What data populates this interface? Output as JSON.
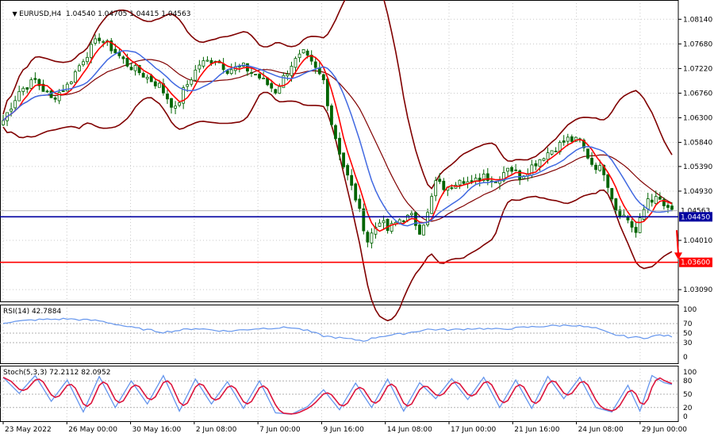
{
  "header": {
    "symbol": "EURUSD,H4",
    "ohlc": "1.04540 1.04705 1.04415 1.04563"
  },
  "rsi": {
    "label": "RSI(14) 42.7884",
    "axis_labels": [
      "100",
      "70",
      "50",
      "30",
      "0"
    ]
  },
  "stoch": {
    "label": "Stoch(5,3,3) 72.2112 82.0952",
    "axis_labels": [
      "100",
      "80",
      "50",
      "20",
      "0"
    ]
  },
  "colors": {
    "candle": "#006400",
    "bollinger": "#800000",
    "fast_ma": "#ff0000",
    "slow_ma": "#4169e1",
    "support_line": "#0000a0",
    "target_line": "#ff0000",
    "arrow": "#ff0000",
    "rsi": "#6495ed",
    "stoch_main": "#6495ed",
    "stoch_signal": "#dc143c"
  },
  "chart_data": {
    "type": "candlestick",
    "symbol": "EURUSD",
    "timeframe": "H4",
    "price_axis": {
      "labels": [
        "1.08140",
        "1.07680",
        "1.07220",
        "1.06760",
        "1.06300",
        "1.05840",
        "1.05390",
        "1.04930",
        "1.04010",
        "1.03090"
      ],
      "ylim": [
        1.0287,
        1.085
      ]
    },
    "time_axis": {
      "labels": [
        "23 May 2022",
        "26 May 00:00",
        "30 May 16:00",
        "2 Jun 08:00",
        "7 Jun 00:00",
        "9 Jun 16:00",
        "14 Jun 08:00",
        "17 Jun 00:00",
        "21 Jun 16:00",
        "24 Jun 08:00",
        "29 Jun 00:00"
      ],
      "bars": 168
    },
    "current_price": {
      "value": 1.04563,
      "label": "1.04563"
    },
    "horizontal_lines": [
      {
        "value": 1.0445,
        "label": "1.04450",
        "color": "#0000a0"
      },
      {
        "value": 1.036,
        "label": "1.03600",
        "color": "#ff0000"
      }
    ],
    "arrow": {
      "from_bar": 168,
      "from_price": 1.042,
      "to_price": 1.0365,
      "direction": "down"
    },
    "close_anchors": [
      [
        0,
        1.0625
      ],
      [
        4,
        1.068
      ],
      [
        8,
        1.07
      ],
      [
        12,
        1.0665
      ],
      [
        16,
        1.069
      ],
      [
        20,
        1.074
      ],
      [
        24,
        1.078
      ],
      [
        27,
        1.076
      ],
      [
        31,
        1.073
      ],
      [
        35,
        1.071
      ],
      [
        39,
        1.069
      ],
      [
        43,
        1.0645
      ],
      [
        45,
        1.068
      ],
      [
        49,
        1.073
      ],
      [
        53,
        1.074
      ],
      [
        56,
        1.072
      ],
      [
        60,
        1.0725
      ],
      [
        64,
        1.0705
      ],
      [
        68,
        1.068
      ],
      [
        72,
        1.073
      ],
      [
        75,
        1.075
      ],
      [
        78,
        1.072
      ],
      [
        80,
        1.07
      ],
      [
        82,
        1.062
      ],
      [
        85,
        1.054
      ],
      [
        88,
        1.048
      ],
      [
        91,
        1.04
      ],
      [
        94,
        1.044
      ],
      [
        96,
        1.042
      ],
      [
        99,
        1.044
      ],
      [
        102,
        1.0445
      ],
      [
        104,
        1.042
      ],
      [
        106,
        1.045
      ],
      [
        108,
        1.051
      ],
      [
        111,
        1.0495
      ],
      [
        114,
        1.052
      ],
      [
        117,
        1.0505
      ],
      [
        120,
        1.0525
      ],
      [
        123,
        1.051
      ],
      [
        126,
        1.054
      ],
      [
        129,
        1.052
      ],
      [
        132,
        1.054
      ],
      [
        135,
        1.056
      ],
      [
        138,
        1.0575
      ],
      [
        141,
        1.059
      ],
      [
        144,
        1.0585
      ],
      [
        147,
        1.0545
      ],
      [
        150,
        1.053
      ],
      [
        153,
        1.046
      ],
      [
        156,
        1.044
      ],
      [
        158,
        1.0415
      ],
      [
        161,
        1.048
      ],
      [
        164,
        1.0475
      ],
      [
        166,
        1.0456
      ],
      [
        167,
        1.0456
      ]
    ],
    "rsi_anchors": [
      [
        0,
        72
      ],
      [
        8,
        78
      ],
      [
        16,
        80
      ],
      [
        24,
        76
      ],
      [
        32,
        62
      ],
      [
        40,
        52
      ],
      [
        48,
        60
      ],
      [
        56,
        54
      ],
      [
        64,
        60
      ],
      [
        72,
        62
      ],
      [
        76,
        55
      ],
      [
        80,
        44
      ],
      [
        86,
        38
      ],
      [
        90,
        34
      ],
      [
        94,
        43
      ],
      [
        100,
        49
      ],
      [
        106,
        58
      ],
      [
        112,
        57
      ],
      [
        118,
        60
      ],
      [
        124,
        58
      ],
      [
        130,
        62
      ],
      [
        136,
        65
      ],
      [
        142,
        67
      ],
      [
        148,
        60
      ],
      [
        152,
        48
      ],
      [
        156,
        42
      ],
      [
        160,
        40
      ],
      [
        164,
        46
      ],
      [
        167,
        43
      ]
    ],
    "stoch_anchors": [
      [
        0,
        88
      ],
      [
        4,
        52
      ],
      [
        8,
        92
      ],
      [
        12,
        34
      ],
      [
        16,
        82
      ],
      [
        20,
        10
      ],
      [
        24,
        90
      ],
      [
        28,
        20
      ],
      [
        32,
        80
      ],
      [
        36,
        28
      ],
      [
        40,
        92
      ],
      [
        44,
        12
      ],
      [
        48,
        84
      ],
      [
        52,
        28
      ],
      [
        56,
        78
      ],
      [
        60,
        18
      ],
      [
        64,
        80
      ],
      [
        68,
        8
      ],
      [
        72,
        5
      ],
      [
        76,
        22
      ],
      [
        80,
        60
      ],
      [
        84,
        15
      ],
      [
        88,
        75
      ],
      [
        92,
        20
      ],
      [
        96,
        84
      ],
      [
        100,
        12
      ],
      [
        104,
        76
      ],
      [
        108,
        40
      ],
      [
        112,
        85
      ],
      [
        116,
        38
      ],
      [
        120,
        88
      ],
      [
        124,
        20
      ],
      [
        128,
        82
      ],
      [
        132,
        18
      ],
      [
        136,
        90
      ],
      [
        140,
        40
      ],
      [
        144,
        88
      ],
      [
        148,
        20
      ],
      [
        152,
        10
      ],
      [
        156,
        70
      ],
      [
        159,
        12
      ],
      [
        162,
        92
      ],
      [
        165,
        76
      ],
      [
        167,
        72
      ]
    ]
  }
}
